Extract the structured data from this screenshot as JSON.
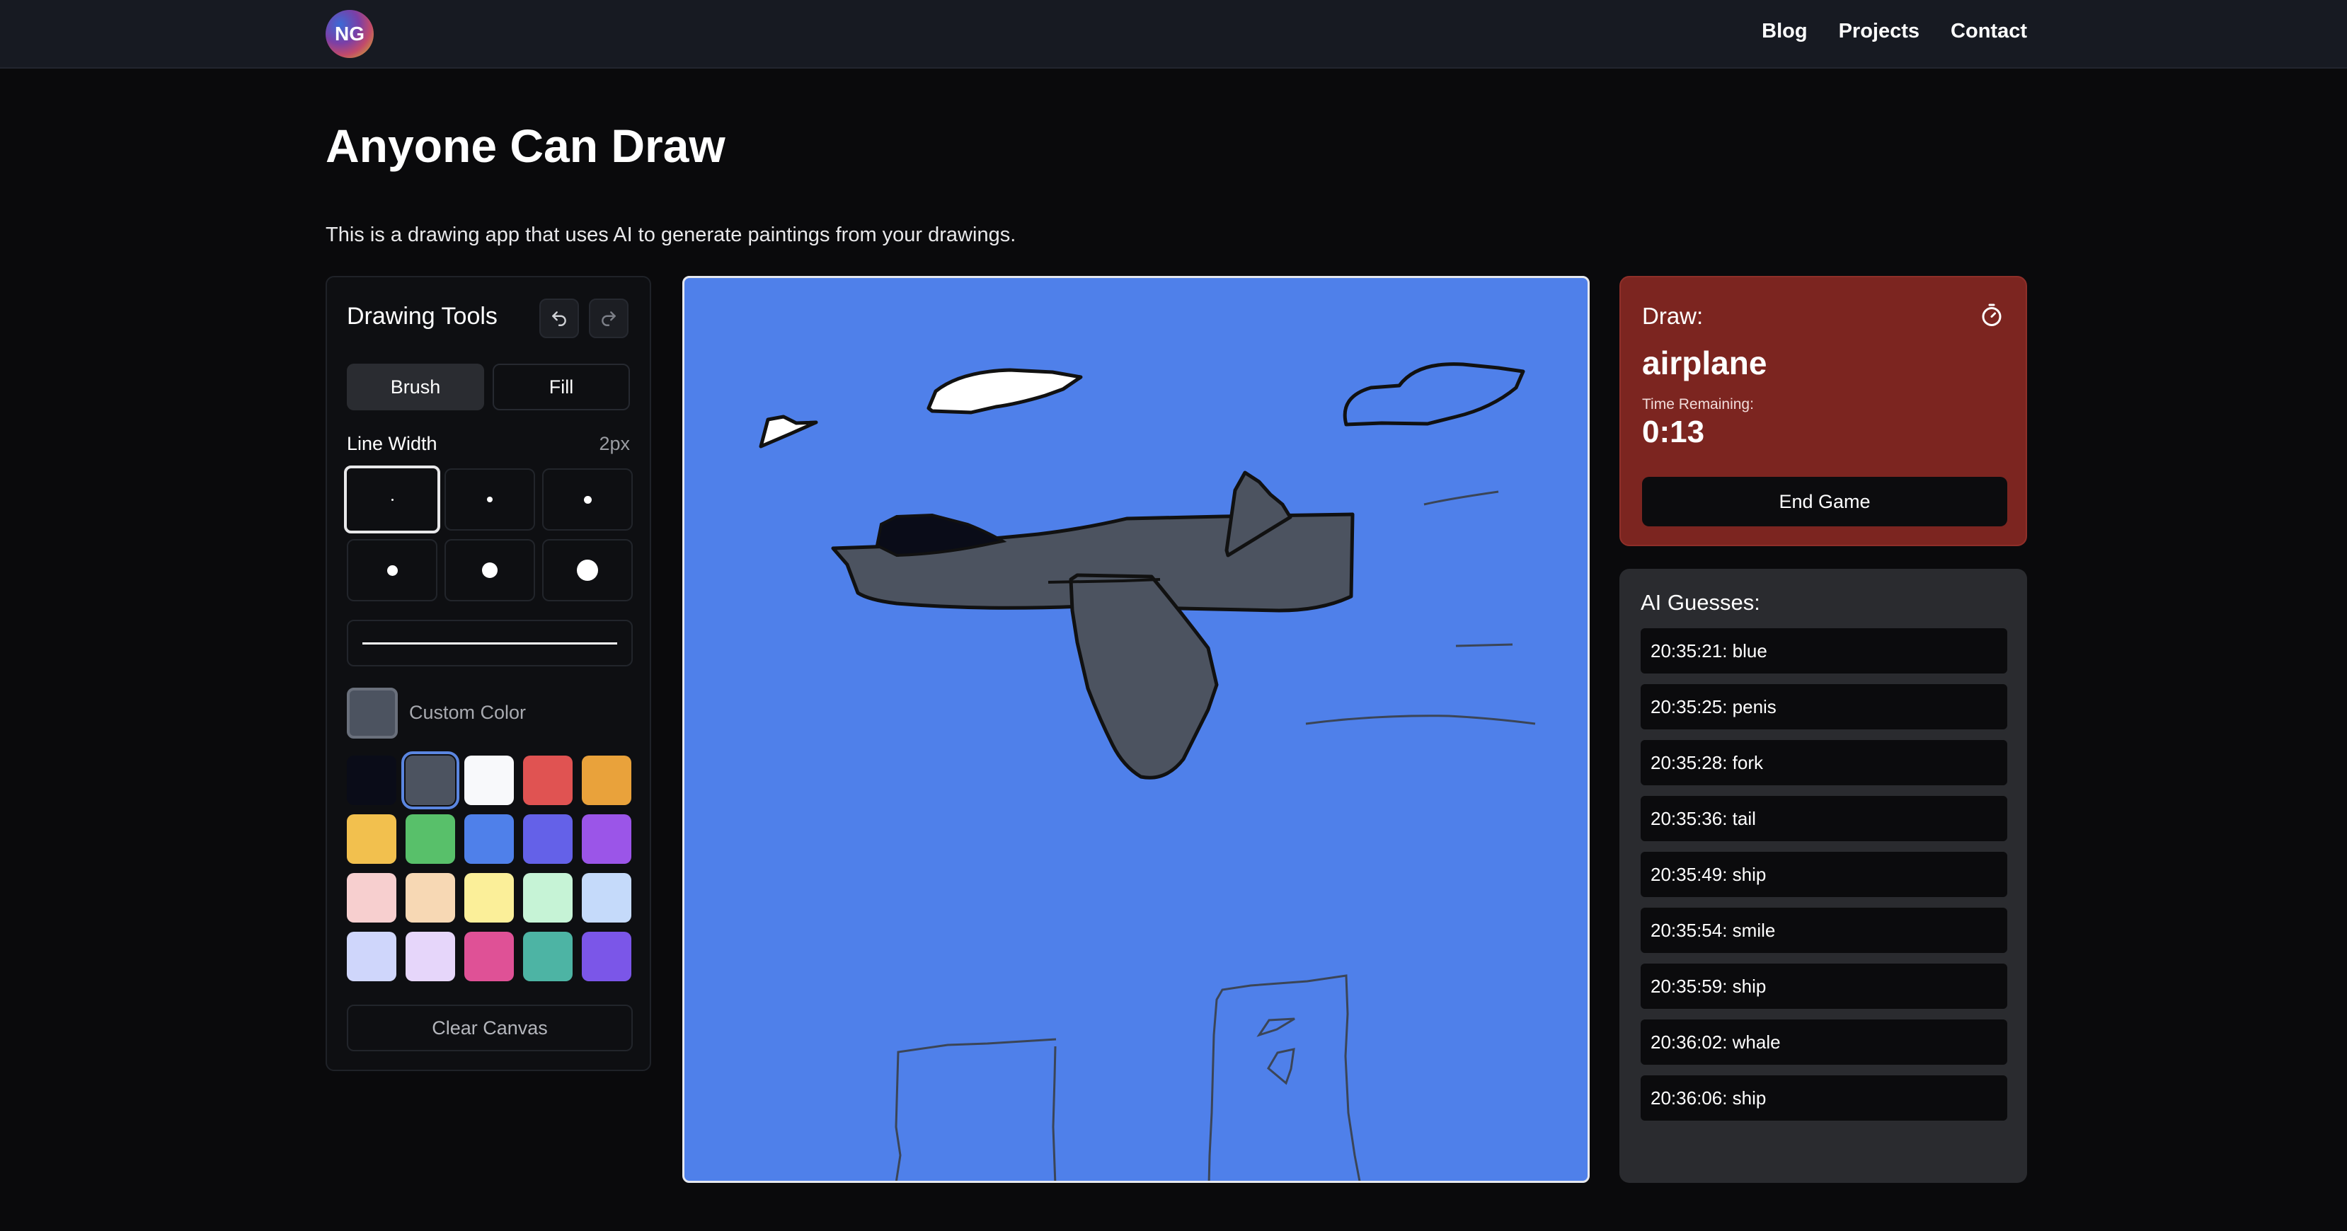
{
  "nav": {
    "logo": "NG",
    "links": [
      "Blog",
      "Projects",
      "Contact"
    ]
  },
  "page": {
    "title": "Anyone Can Draw",
    "description": "This is a drawing app that uses AI to generate paintings from your drawings."
  },
  "tools": {
    "title": "Drawing Tools",
    "undo_icon": "undo-icon",
    "redo_icon": "redo-icon",
    "modes": [
      "Brush",
      "Fill"
    ],
    "active_mode": "Brush",
    "line_width_label": "Line Width",
    "line_width_value": "2px",
    "custom_color_label": "Custom Color",
    "custom_color": "#4c5360",
    "selected_color": "#4c5360",
    "palette": [
      "#0a0c18",
      "#4c5360",
      "#f8f9fb",
      "#e05352",
      "#e9a23b",
      "#f2c04e",
      "#58c06a",
      "#4f80ea",
      "#6461e8",
      "#9b55e8",
      "#f7cfcf",
      "#f7d8b4",
      "#fbef99",
      "#c6f3d6",
      "#c5dafa",
      "#cfd6fb",
      "#e6d6fa",
      "#df5196",
      "#4db4a4",
      "#7b56e8"
    ],
    "clear_label": "Clear Canvas"
  },
  "canvas": {
    "background": "#4f80ea"
  },
  "prompt": {
    "label": "Draw:",
    "word": "airplane",
    "time_label": "Time Remaining:",
    "time_value": "0:13",
    "end_button": "End Game",
    "timer_icon": "timer-icon"
  },
  "guesses": {
    "title": "AI Guesses:",
    "items": [
      "20:35:21: blue",
      "20:35:25: penis",
      "20:35:28: fork",
      "20:35:36: tail",
      "20:35:49: ship",
      "20:35:54: smile",
      "20:35:59: ship",
      "20:36:02: whale",
      "20:36:06: ship"
    ]
  }
}
